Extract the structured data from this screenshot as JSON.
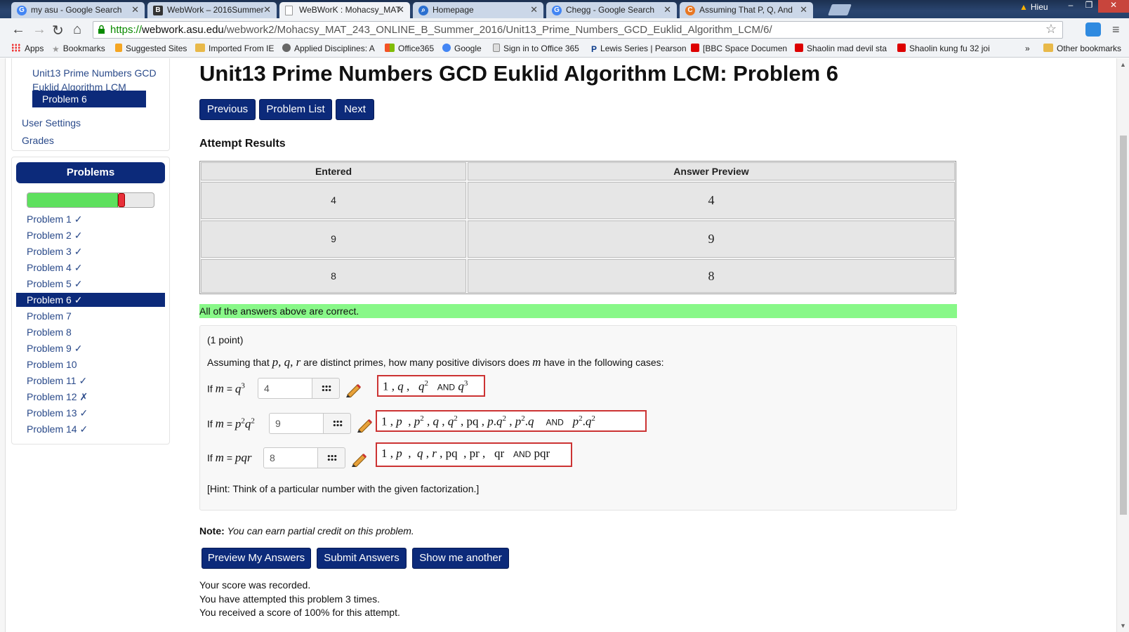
{
  "browser": {
    "tabs": [
      {
        "label": "my asu - Google Search",
        "icon": "google-icon"
      },
      {
        "label": "WebWork – 2016Summer",
        "icon": "blackboard-icon"
      },
      {
        "label": "WeBWorK : Mohacsy_MAT",
        "icon": "page-icon"
      },
      {
        "label": "Homepage",
        "icon": "search-icon"
      },
      {
        "label": "Chegg - Google Search",
        "icon": "google-icon"
      },
      {
        "label": "Assuming That P, Q, And",
        "icon": "chegg-icon"
      }
    ],
    "profile_name": "Hieu",
    "url_scheme": "https://",
    "url_host": "webwork.asu.edu",
    "url_path": "/webwork2/Mohacsy_MAT_243_ONLINE_B_Summer_2016/Unit13_Prime_Numbers_GCD_Euklid_Algorithm_LCM/6/",
    "bookmarks": [
      "Apps",
      "Bookmarks",
      "Suggested Sites",
      "Imported From IE",
      "Applied Disciplines: A",
      "Office365",
      "Google",
      "Sign in to Office 365",
      "Lewis Series | Pearson",
      "[BBC Space Documen",
      "Shaolin mad devil sta",
      "Shaolin kung fu 32 joi",
      "»",
      "Other bookmarks"
    ]
  },
  "sidebar": {
    "set_label_line1": "Unit13 Prime Numbers GCD",
    "set_label_line2": "Euklid Algorithm LCM",
    "active_problem": "Problem 6",
    "user_settings": "User Settings",
    "grades": "Grades",
    "problems_header": "Problems",
    "progress_fraction": 0.75,
    "problems": [
      "Problem 1 ✓",
      "Problem 2 ✓",
      "Problem 3 ✓",
      "Problem 4 ✓",
      "Problem 5 ✓",
      "Problem 6 ✓",
      "Problem 7",
      "Problem 8",
      "Problem 9 ✓",
      "Problem 10",
      "Problem 11 ✓",
      "Problem 12 ✗",
      "Problem 13 ✓",
      "Problem 14 ✓"
    ]
  },
  "main": {
    "title": "Unit13 Prime Numbers GCD Euklid Algorithm LCM: Problem 6",
    "nav": {
      "previous": "Previous",
      "problem_list": "Problem List",
      "next": "Next"
    },
    "attempt_heading": "Attempt Results",
    "results_headers": {
      "entered": "Entered",
      "preview": "Answer Preview"
    },
    "results_rows": [
      {
        "entered": "4",
        "preview": "4"
      },
      {
        "entered": "9",
        "preview": "9"
      },
      {
        "entered": "8",
        "preview": "8"
      }
    ],
    "correct_message": "All of the answers above are correct.",
    "points": "(1 point)",
    "question_pre": "Assuming that",
    "question_vars": "p, q, r",
    "question_mid": "are distinct primes, how many positive divisors does",
    "question_m": "m",
    "question_post": "have in the following cases:",
    "if_label": "If",
    "answers": [
      "4",
      "9",
      "8"
    ],
    "hint": "[Hint: Think of a particular number with the given factorization.]",
    "note_label": "Note:",
    "note_text": "You can earn partial credit on this problem.",
    "buttons": {
      "preview": "Preview My Answers",
      "submit": "Submit Answers",
      "another": "Show me another"
    },
    "status_lines": [
      "Your score was recorded.",
      "You have attempted this problem 3 times.",
      "You received a score of 100% for this attempt."
    ]
  },
  "colors": {
    "accent": "#0c2a7a",
    "correct_bg": "#88f888",
    "error_border": "#cc3333"
  }
}
